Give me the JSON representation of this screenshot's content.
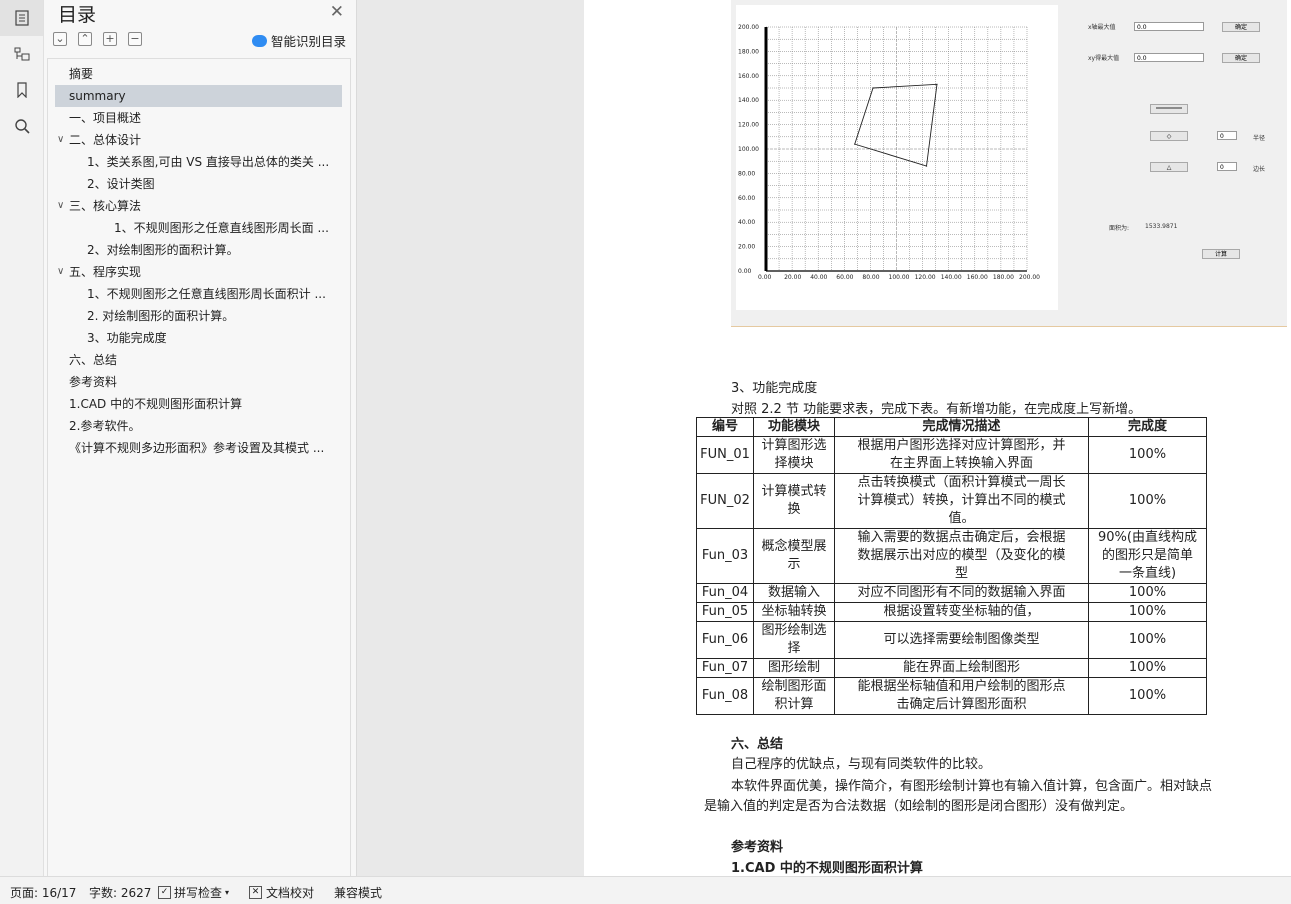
{
  "sidebar": {
    "title": "目录",
    "smart_toc_label": "智能识别目录",
    "toolbar_icons": [
      "collapse-all-icon",
      "expand-all-icon",
      "add-icon",
      "remove-icon"
    ],
    "items": [
      {
        "label": "摘要",
        "level": 1,
        "selected": false,
        "expandable": false
      },
      {
        "label": "summary",
        "level": 1,
        "selected": true,
        "expandable": false
      },
      {
        "label": "一、项目概述",
        "level": 1,
        "selected": false,
        "expandable": false
      },
      {
        "label": "二、总体设计",
        "level": 1,
        "selected": false,
        "expandable": true
      },
      {
        "label": "1、类关系图,可由 VS 直接导出总体的类关 ...",
        "level": 2,
        "selected": false,
        "expandable": false
      },
      {
        "label": "2、设计类图",
        "level": 2,
        "selected": false,
        "expandable": false
      },
      {
        "label": "三、核心算法",
        "level": 1,
        "selected": false,
        "expandable": true
      },
      {
        "label": "1、不规则图形之任意直线图形周长面 ...",
        "level": 3,
        "selected": false,
        "expandable": false
      },
      {
        "label": "2、对绘制图形的面积计算。",
        "level": 2,
        "selected": false,
        "expandable": false
      },
      {
        "label": "五、程序实现",
        "level": 1,
        "selected": false,
        "expandable": true
      },
      {
        "label": "1、不规则图形之任意直线图形周长面积计 ...",
        "level": 2,
        "selected": false,
        "expandable": false
      },
      {
        "label": "2. 对绘制图形的面积计算。",
        "level": 2,
        "selected": false,
        "expandable": false
      },
      {
        "label": "3、功能完成度",
        "level": 2,
        "selected": false,
        "expandable": false
      },
      {
        "label": "六、总结",
        "level": 1,
        "selected": false,
        "expandable": false
      },
      {
        "label": "参考资料",
        "level": 1,
        "selected": false,
        "expandable": false
      },
      {
        "label": "1.CAD 中的不规则图形面积计算",
        "level": 1,
        "selected": false,
        "expandable": false
      },
      {
        "label": "2.参考软件。",
        "level": 1,
        "selected": false,
        "expandable": false
      },
      {
        "label": "《计算不规则多边形面积》参考设置及其模式 ...",
        "level": 1,
        "selected": false,
        "expandable": false
      }
    ]
  },
  "figure": {
    "x_axis_max_label": "x轴最大值",
    "y_axis_max_label": "xy得最大值",
    "x_value": "0.0",
    "y_value": "0.0",
    "confirm_label": "确定",
    "radius_label": "半径",
    "side_label": "边长",
    "area_label": "面积为:",
    "area_value": "1533.9871",
    "calc_label": "计算",
    "spin_value": "0",
    "diamond_symbol": "◇",
    "triangle_symbol": "△"
  },
  "chart_data": {
    "type": "line",
    "title": "",
    "xlabel": "",
    "ylabel": "",
    "xlim": [
      0,
      200
    ],
    "ylim": [
      0,
      200
    ],
    "x_ticks": [
      "0.00",
      "20.00",
      "40.00",
      "60.00",
      "80.00",
      "100.00",
      "120.00",
      "140.00",
      "160.00",
      "180.00",
      "200.00"
    ],
    "y_ticks": [
      "0.00",
      "20.00",
      "40.00",
      "60.00",
      "80.00",
      "100.00",
      "120.00",
      "140.00",
      "160.00",
      "180.00",
      "200.00"
    ],
    "grid": true,
    "series": [
      {
        "points": [
          [
            82,
            150
          ],
          [
            131,
            153
          ],
          [
            123,
            86
          ],
          [
            68,
            104
          ],
          [
            82,
            150
          ]
        ]
      }
    ]
  },
  "doc": {
    "section3_title": "3、功能完成度",
    "section3_intro": "对照 2.2 节 功能要求表，完成下表。有新增功能，在完成度上写新增。",
    "table_headers": [
      "编号",
      "功能模块",
      "完成情况描述",
      "完成度"
    ],
    "table_rows": [
      {
        "id": "FUN_01",
        "module": [
          "计算图形选",
          "择模块"
        ],
        "desc": [
          "根据用户图形选择对应计算图形，并",
          "在主界面上转换输入界面"
        ],
        "done": [
          "100%"
        ]
      },
      {
        "id": "FUN_02",
        "module": [
          "计算模式转",
          "换"
        ],
        "desc": [
          "点击转换模式（面积计算模式一周长",
          "计算模式）转换，计算出不同的模式",
          "值。"
        ],
        "done": [
          "100%"
        ]
      },
      {
        "id": "Fun_03",
        "module": [
          "概念模型展",
          "示"
        ],
        "desc": [
          "输入需要的数据点击确定后，会根据",
          "数据展示出对应的模型（及变化的模",
          "型"
        ],
        "done": [
          "90%(由直线构成",
          "的图形只是简单",
          "一条直线)"
        ]
      },
      {
        "id": "Fun_04",
        "module": [
          "数据输入"
        ],
        "desc": [
          "对应不同图形有不同的数据输入界面"
        ],
        "done": [
          "100%"
        ]
      },
      {
        "id": "Fun_05",
        "module": [
          "坐标轴转换"
        ],
        "desc": [
          "根据设置转变坐标轴的值，"
        ],
        "done": [
          "100%"
        ]
      },
      {
        "id": "Fun_06",
        "module": [
          "图形绘制选",
          "择"
        ],
        "desc": [
          "可以选择需要绘制图像类型"
        ],
        "done": [
          "100%"
        ]
      },
      {
        "id": "Fun_07",
        "module": [
          "图形绘制"
        ],
        "desc": [
          "能在界面上绘制图形"
        ],
        "done": [
          "100%"
        ]
      },
      {
        "id": "Fun_08",
        "module": [
          "绘制图形面",
          "积计算"
        ],
        "desc": [
          "能根据坐标轴值和用户绘制的图形点",
          "击确定后计算图形面积"
        ],
        "done": [
          "100%"
        ]
      }
    ],
    "section6_title": "六、总结",
    "section6_p1": "自己程序的优缺点，与现有同类软件的比较。",
    "section6_p2a": "本软件界面优美，操作简介，有图形绘制计算也有输入值计算，包含面广。相对缺点",
    "section6_p2b": "是输入值的判定是否为合法数据（如绘制的图形是闭合图形）没有做判定。",
    "refs_title": "参考资料",
    "ref1": "1.CAD 中的不规则图形面积计算"
  },
  "statusbar": {
    "page": "页面: 16/17",
    "words": "字数: 2627",
    "spell": "拼写检查",
    "proof": "文档校对",
    "compat": "兼容模式"
  }
}
